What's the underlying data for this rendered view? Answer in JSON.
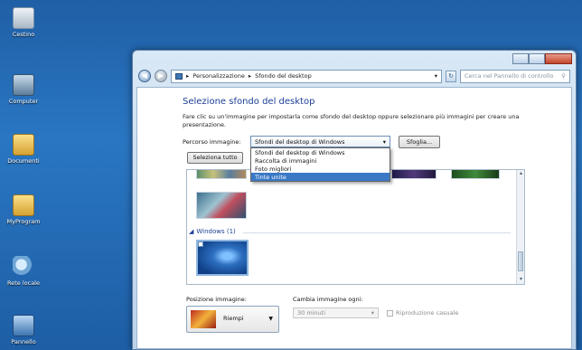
{
  "desktop": {
    "icons": [
      {
        "label": "Cestino",
        "icon": "recycle-bin-icon"
      },
      {
        "label": "Computer",
        "icon": "computer-icon"
      },
      {
        "label": "Documenti",
        "icon": "folder-icon"
      },
      {
        "label": "MyProgram",
        "icon": "folder-icon"
      },
      {
        "label": "Rete locale",
        "icon": "network-icon"
      },
      {
        "label": "Pannello",
        "icon": "control-panel-icon"
      }
    ]
  },
  "window": {
    "address": {
      "root_icon": "control-panel-icon",
      "crumb1": "Personalizzazione",
      "crumb2": "Sfondo del desktop"
    },
    "search_placeholder": "Cerca nel Pannello di controllo",
    "title": "Selezione sfondo del desktop",
    "description": "Fare clic su un'immagine per impostarla come sfondo del desktop oppure selezionare più immagini per creare una presentazione.",
    "location_label": "Percorso immagine:",
    "location_value": "Sfondi del desktop di Windows",
    "browse_label": "Sfoglia...",
    "select_all_label": "Seleziona tutto",
    "dropdown_options": [
      "Sfondi del desktop di Windows",
      "Raccolta di immagini",
      "Foto migliori",
      "Tinte unite"
    ],
    "dropdown_selected": "Tinte unite",
    "group_label": "Windows (1)",
    "position_label": "Posizione immagine:",
    "position_value": "Riempi",
    "interval_label": "Cambia immagine ogni:",
    "interval_value": "30 minuti",
    "shuffle_label": "Riproduzione casuale"
  },
  "colors": {
    "accent": "#1e3f95",
    "selection": "#3a78c5",
    "desktop": "#2a76c2"
  }
}
